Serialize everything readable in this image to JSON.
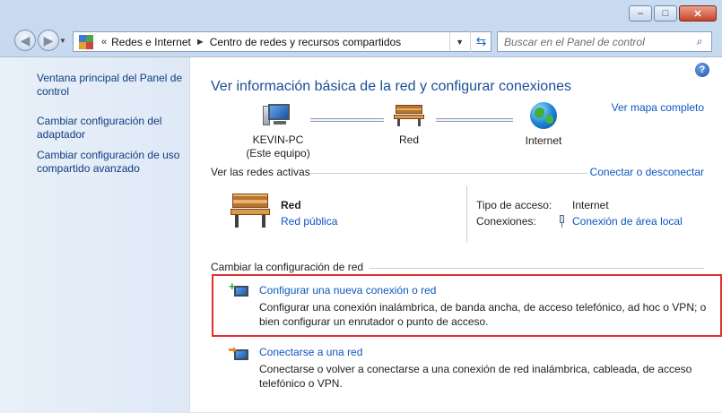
{
  "window": {
    "minimize_glyph": "–",
    "maximize_glyph": "□",
    "close_glyph": "✕"
  },
  "address_bar": {
    "prefix": "«",
    "crumbs": [
      "Redes e Internet",
      "Centro de redes y recursos compartidos"
    ],
    "separator": "►"
  },
  "search": {
    "placeholder": "Buscar en el Panel de control"
  },
  "sidebar": {
    "items": [
      {
        "label": "Ventana principal del Panel de control"
      },
      {
        "label": "Cambiar configuración del adaptador"
      },
      {
        "label": "Cambiar configuración de uso compartido avanzado"
      }
    ]
  },
  "main": {
    "title": "Ver información básica de la red y configurar conexiones",
    "full_map_link": "Ver mapa completo",
    "map": {
      "computer_name": "KEVIN-PC",
      "computer_sub": "(Este equipo)",
      "network": "Red",
      "internet": "Internet"
    },
    "active_networks": {
      "title": "Ver las redes activas",
      "connect_link": "Conectar o desconectar",
      "network_name": "Red",
      "network_type": "Red pública",
      "access_type_label": "Tipo de acceso:",
      "access_type_value": "Internet",
      "connections_label": "Conexiones:",
      "connections_value": "Conexión de área local"
    },
    "change_settings": {
      "title": "Cambiar la configuración de red",
      "tasks": [
        {
          "title": "Configurar una nueva conexión o red",
          "desc": "Configurar una conexión inalámbrica, de banda ancha, de acceso telefónico, ad hoc o VPN; o bien configurar un enrutador o punto de acceso."
        },
        {
          "title": "Conectarse a una red",
          "desc": "Conectarse o volver a conectarse a una conexión de red inalámbrica, cableada, de acceso telefónico o VPN."
        }
      ]
    }
  },
  "colors": {
    "link": "#0e56c0",
    "heading": "#1b4d96",
    "highlight_border": "#e03030"
  }
}
